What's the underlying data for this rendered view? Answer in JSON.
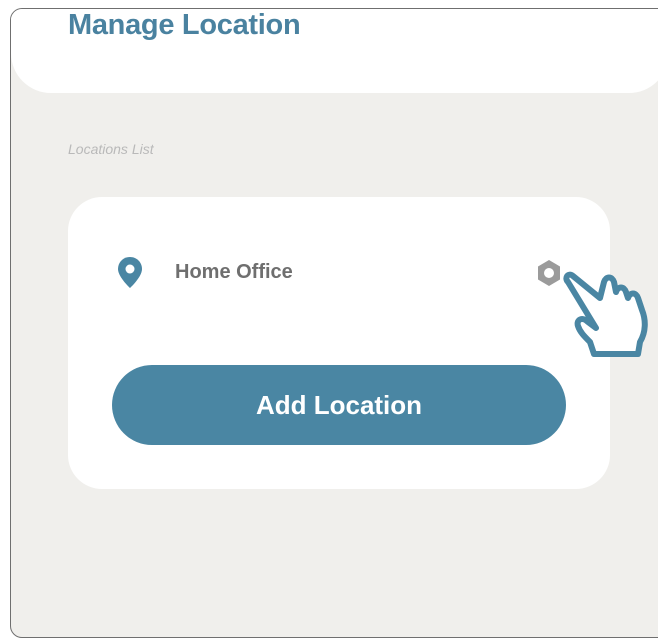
{
  "header": {
    "title": "Manage Location"
  },
  "section": {
    "label": "Locations List"
  },
  "locations": [
    {
      "name": "Home Office"
    }
  ],
  "actions": {
    "add_label": "Add Location"
  },
  "colors": {
    "accent": "#4a86a3",
    "title": "#4a82a0",
    "background": "#f0efec",
    "icon_gray": "#9b9b9b"
  },
  "icons": {
    "location": "map-pin-icon",
    "settings": "hexagon-settings-icon",
    "cursor": "pointing-hand-icon"
  }
}
